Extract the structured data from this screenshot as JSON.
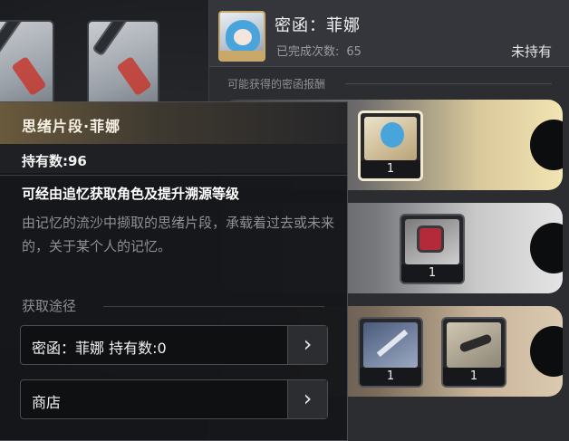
{
  "profile": {
    "name": "密函：菲娜",
    "completed_label": "已完成次数:",
    "completed_value": "65",
    "status": "未持有"
  },
  "rewards": {
    "title": "可能获得的密函报酬",
    "rows": [
      {
        "items": [
          {
            "icon": "fragment-icon",
            "qty": "1"
          }
        ]
      },
      {
        "items": [
          {
            "icon": "box-icon",
            "qty": "1"
          }
        ]
      },
      {
        "items": [
          {
            "icon": "blade-icon",
            "qty": "1"
          },
          {
            "icon": "tool-icon",
            "qty": "1"
          }
        ]
      }
    ]
  },
  "tooltip": {
    "title": "思绪片段·菲娜",
    "owned": "持有数:96",
    "obtain_desc": "可经由追忆获取角色及提升溯源等级",
    "flavor": "由记忆的流沙中撷取的思绪片段，承载着过去或未来的，关于某个人的记忆。",
    "source_heading": "获取途径",
    "sources": [
      {
        "label": "密函：菲娜 持有数:0"
      },
      {
        "label": "商店"
      }
    ],
    "arrow_glyph": "›"
  },
  "colors": {
    "accent_gold": "#c9a96a",
    "panel": "#2b2d31",
    "tooltip_bg": "#16171a"
  }
}
